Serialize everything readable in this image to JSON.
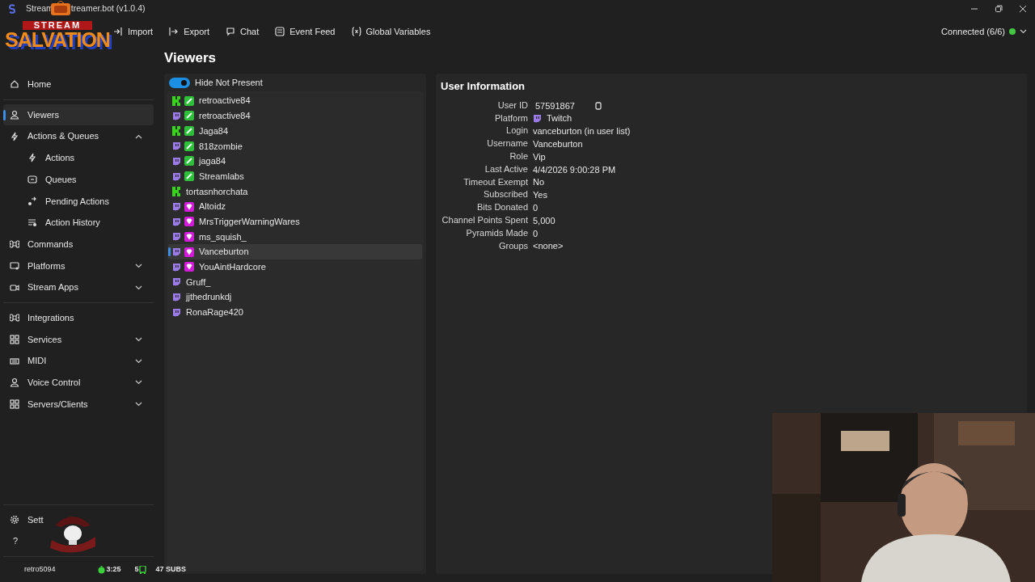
{
  "window": {
    "title_parts": [
      "Stream",
      "treamer.bot (v1.0.4)"
    ]
  },
  "toolbar": [
    {
      "label": "Import",
      "kind": "import"
    },
    {
      "label": "Export",
      "kind": "export"
    },
    {
      "label": "Chat",
      "kind": "chat"
    },
    {
      "label": "Event Feed",
      "kind": "feed"
    },
    {
      "label": "Global Variables",
      "kind": "vars"
    }
  ],
  "connection": {
    "label": "Connected (6/6)",
    "color": "#43c743"
  },
  "overlay_logo": {
    "line1": "STREAM",
    "line2": "SALVATION"
  },
  "sidebar": {
    "items": [
      {
        "kind": "home",
        "label": "Home",
        "selected": false
      },
      {
        "kind": "divider"
      },
      {
        "kind": "user",
        "label": "Viewers",
        "selected": true
      },
      {
        "kind": "bolt",
        "label": "Actions & Queues",
        "selected": false,
        "expanded": true,
        "children": [
          {
            "label": "Actions",
            "kind": "bolt",
            "selected": false
          },
          {
            "label": "Queues",
            "kind": "queue",
            "selected": false
          },
          {
            "label": "Pending Actions",
            "kind": "pending",
            "selected": false
          },
          {
            "label": "Action History",
            "kind": "history",
            "selected": false
          }
        ]
      },
      {
        "kind": "cmd",
        "label": "Commands",
        "selected": false
      },
      {
        "kind": "screen",
        "label": "Platforms",
        "selected": false,
        "expanded": false
      },
      {
        "kind": "camera",
        "label": "Stream Apps",
        "selected": false,
        "expanded": false
      },
      {
        "kind": "divider"
      },
      {
        "kind": "cmd",
        "label": "Integrations",
        "selected": false
      },
      {
        "kind": "grid",
        "label": "Services",
        "selected": false,
        "expanded": false
      },
      {
        "kind": "keys",
        "label": "MIDI",
        "selected": false,
        "expanded": false
      },
      {
        "kind": "user",
        "label": "Voice Control",
        "selected": false,
        "expanded": false
      },
      {
        "kind": "grid",
        "label": "Servers/Clients",
        "selected": false,
        "expanded": false
      }
    ],
    "bottom": [
      {
        "label": "Sett",
        "kind": "gear"
      },
      {
        "label": "?",
        "kind": "help"
      }
    ]
  },
  "page_title": "Viewers",
  "viewers": {
    "toggle": {
      "label": "Hide Not Present",
      "on": true
    },
    "rows": [
      {
        "name": "retroactive84",
        "icons": [
          {
            "kind": "kick"
          },
          {
            "kind": "mod"
          }
        ],
        "selected": false
      },
      {
        "name": "retroactive84",
        "icons": [
          {
            "kind": "twitch"
          },
          {
            "kind": "mod"
          }
        ],
        "selected": false
      },
      {
        "name": "Jaga84",
        "icons": [
          {
            "kind": "kick"
          },
          {
            "kind": "mod"
          }
        ],
        "selected": false
      },
      {
        "name": "818zombie",
        "icons": [
          {
            "kind": "twitch"
          },
          {
            "kind": "mod"
          }
        ],
        "selected": false
      },
      {
        "name": "jaga84",
        "icons": [
          {
            "kind": "twitch"
          },
          {
            "kind": "mod"
          }
        ],
        "selected": false
      },
      {
        "name": "Streamlabs",
        "icons": [
          {
            "kind": "twitch"
          },
          {
            "kind": "mod"
          }
        ],
        "selected": false
      },
      {
        "name": "tortasnhorchata",
        "icons": [
          {
            "kind": "kick"
          }
        ],
        "selected": false
      },
      {
        "name": "Altoidz",
        "icons": [
          {
            "kind": "twitch"
          },
          {
            "kind": "vip"
          }
        ],
        "selected": false
      },
      {
        "name": "MrsTriggerWarningWares",
        "icons": [
          {
            "kind": "twitch"
          },
          {
            "kind": "vip"
          }
        ],
        "selected": false
      },
      {
        "name": "ms_squish_",
        "icons": [
          {
            "kind": "twitch"
          },
          {
            "kind": "vip"
          }
        ],
        "selected": false
      },
      {
        "name": "Vanceburton",
        "icons": [
          {
            "kind": "twitch"
          },
          {
            "kind": "vip"
          }
        ],
        "selected": true
      },
      {
        "name": "YouAintHardcore",
        "icons": [
          {
            "kind": "twitch"
          },
          {
            "kind": "vip"
          }
        ],
        "selected": false
      },
      {
        "name": "Gruff_",
        "icons": [
          {
            "kind": "twitch"
          }
        ],
        "selected": false
      },
      {
        "name": "jjthedrunkdj",
        "icons": [
          {
            "kind": "twitch"
          }
        ],
        "selected": false
      },
      {
        "name": "RonaRage420",
        "icons": [
          {
            "kind": "twitch"
          }
        ],
        "selected": false
      }
    ]
  },
  "user_info": {
    "title": "User Information",
    "fields": [
      {
        "label": "User ID",
        "value": "57591867",
        "kind": "copy"
      },
      {
        "label": "Platform",
        "value": "Twitch",
        "kind": "twitch"
      },
      {
        "label": "Login",
        "value": "vanceburton (in user list)",
        "kind": "text"
      },
      {
        "label": "Username",
        "value": "Vanceburton",
        "kind": "text"
      },
      {
        "label": "Role",
        "value": "Vip",
        "kind": "text"
      },
      {
        "label": "Last Active",
        "value": "4/4/2026 9:00:28 PM",
        "kind": "text"
      },
      {
        "label": "Timeout Exempt",
        "value": "No",
        "kind": "text"
      },
      {
        "label": "Subscribed",
        "value": "Yes",
        "kind": "text"
      },
      {
        "label": "Bits Donated",
        "value": "0",
        "kind": "text"
      },
      {
        "label": "Channel Points Spent",
        "value": "5,000",
        "kind": "text"
      },
      {
        "label": "Pyramids Made",
        "value": "0",
        "kind": "text"
      },
      {
        "label": "Groups",
        "value": "<none>",
        "kind": "text"
      }
    ]
  },
  "stream_stats": {
    "user": "retro5094",
    "timer": "3:25",
    "count": "5",
    "subs": "47 SUBS"
  }
}
